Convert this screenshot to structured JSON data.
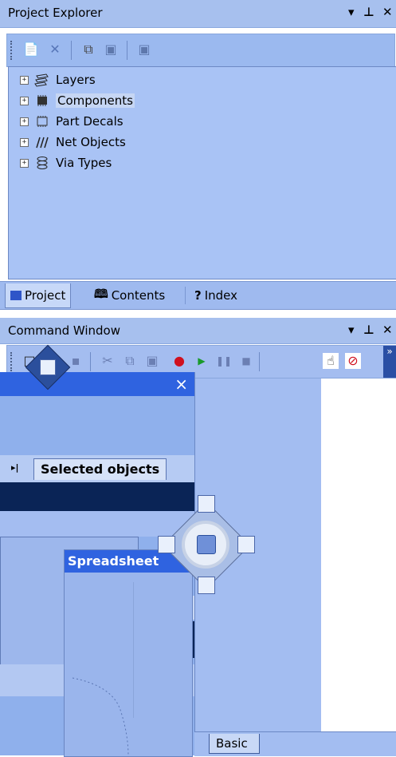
{
  "project_explorer": {
    "title": "Project Explorer",
    "pin_glyph": "▾ ⊥ ✕",
    "toolbar_icons": [
      "new-icon",
      "delete-icon",
      "copy-icon",
      "paste-icon",
      "properties-icon"
    ],
    "tree": [
      {
        "label": "Layers",
        "icon": "layers-icon"
      },
      {
        "label": "Components",
        "icon": "components-icon"
      },
      {
        "label": "Part Decals",
        "icon": "part-decals-icon"
      },
      {
        "label": "Net Objects",
        "icon": "net-objects-icon"
      },
      {
        "label": "Via Types",
        "icon": "via-types-icon"
      }
    ],
    "tabs": [
      {
        "label": "Project",
        "icon": "project-icon"
      },
      {
        "label": "Contents",
        "icon": "contents-icon"
      },
      {
        "label": "Index",
        "icon": "index-icon"
      }
    ]
  },
  "command_window": {
    "title": "Command Window",
    "toolbar_icons": [
      "new-icon",
      "open-icon",
      "save-icon",
      "cut-icon",
      "copy-icon",
      "paste-icon",
      "record-icon",
      "play-icon",
      "pause-icon",
      "stop-icon",
      "hand-icon",
      "stop-sign-icon"
    ]
  },
  "floating_panel": {
    "close_label": "×",
    "tab_label": "Selected objects",
    "nav_label": "▸|",
    "spreadsheet_label": "Spreadsheet",
    "first_label": "|◂ ◂",
    "basic_tab_label": "Basic"
  },
  "colors": {
    "accent": "#7b9ff0",
    "dark_navy": "#0a2456",
    "dock_blue": "#2b4f9c"
  }
}
